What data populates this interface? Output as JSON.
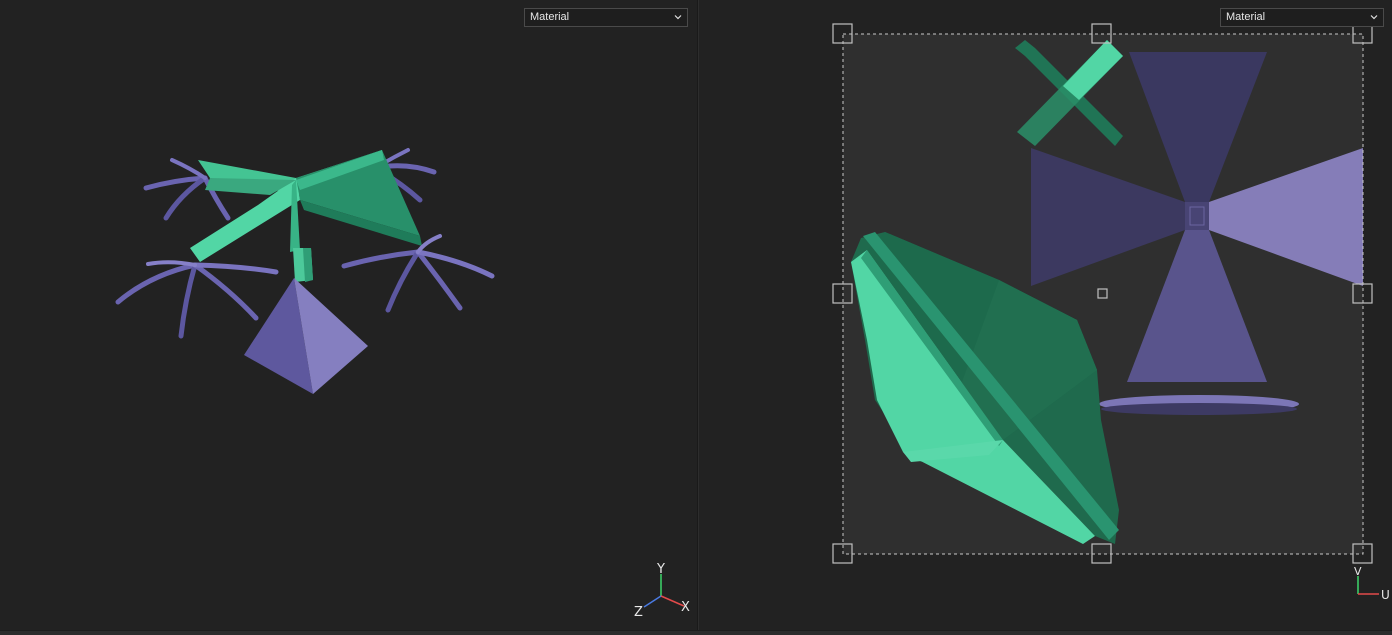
{
  "viewport3d": {
    "shading_mode": "Material",
    "axis_gizmo": {
      "x": "X",
      "y": "Y",
      "z": "Z"
    }
  },
  "uv_editor": {
    "shading_mode": "Material",
    "axis_gizmo": {
      "u": "U",
      "v": "V"
    }
  },
  "colors": {
    "background": "#222222",
    "green_light": "#4fcfa0",
    "green_dark": "#1f6e4f",
    "purple_light": "#8a82c2",
    "purple_dark": "#3d3a63"
  },
  "icons": [
    "chevron-down-icon",
    "xyz-axis-gizmo-icon",
    "uv-axis-gizmo-icon"
  ]
}
